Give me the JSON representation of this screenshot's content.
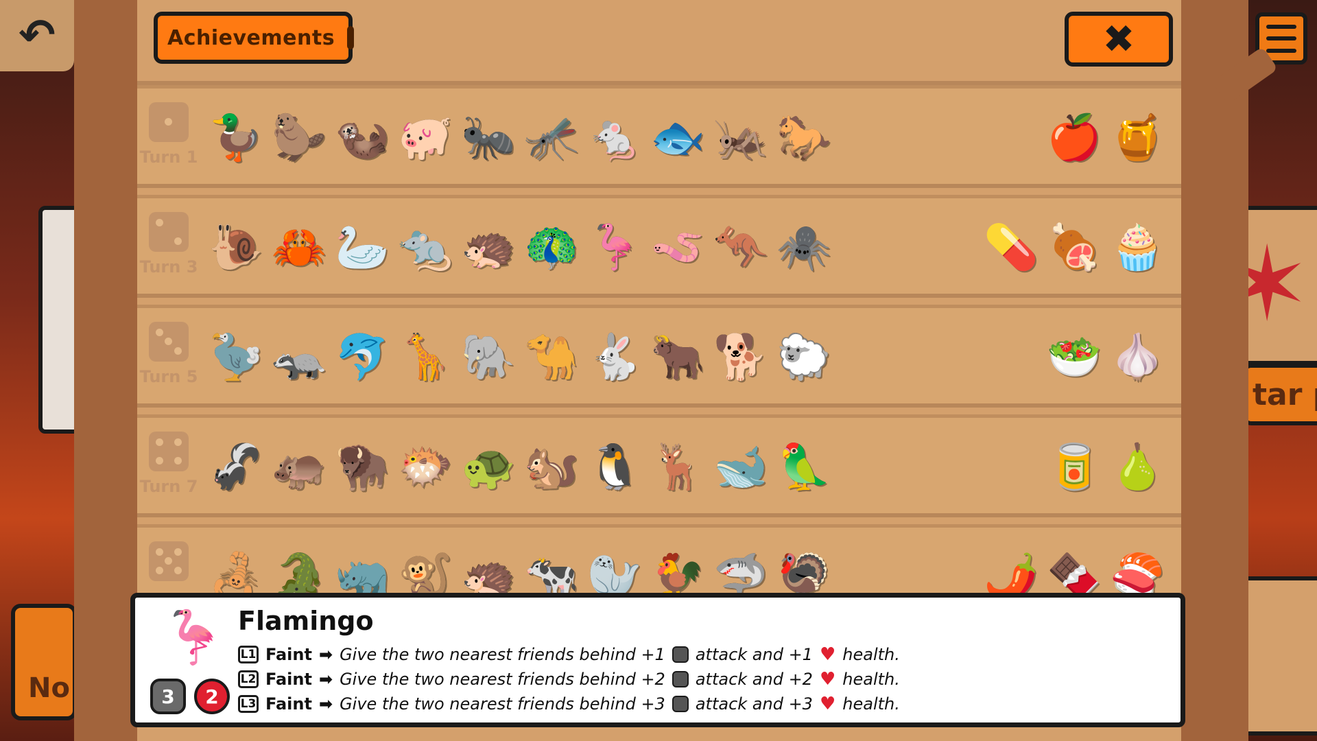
{
  "header": {
    "achievements_label": "Achievements",
    "close_label": "✖"
  },
  "tiers": [
    {
      "turn": "Turn 1",
      "pips": 1,
      "pets": [
        "🦆",
        "🦫",
        "🦦",
        "🐖",
        "🐜",
        "🦟",
        "🐁",
        "🐟",
        "🦗",
        "🐎"
      ],
      "foods": [
        "🍎",
        "🍯"
      ]
    },
    {
      "turn": "Turn 3",
      "pips": 2,
      "pets": [
        "🐌",
        "🦀",
        "🦢",
        "🐀",
        "🦔",
        "🦚",
        "🦩",
        "🪱",
        "🦘",
        "🕷️"
      ],
      "foods": [
        "💊",
        "🍖",
        "🧁"
      ]
    },
    {
      "turn": "Turn 5",
      "pips": 3,
      "pets": [
        "🦤",
        "🦡",
        "🐬",
        "🦒",
        "🐘",
        "🐪",
        "🐇",
        "🐂",
        "🐕",
        "🐑"
      ],
      "foods": [
        "🥗",
        "🧄"
      ]
    },
    {
      "turn": "Turn 7",
      "pips": 4,
      "pets": [
        "🦨",
        "🦛",
        "🦬",
        "🐡",
        "🐢",
        "🐿️",
        "🐧",
        "🦌",
        "🐋",
        "🦜"
      ],
      "foods": [
        "🥫",
        "🍐"
      ]
    },
    {
      "turn": "",
      "pips": 5,
      "pets": [
        "🦂",
        "🐊",
        "🦏",
        "🐒",
        "🦔",
        "🐄",
        "🦭",
        "🐓",
        "🦈",
        "🦃"
      ],
      "foods": [
        "🌶️",
        "🍫",
        "🍣"
      ]
    }
  ],
  "info": {
    "icon": "🦩",
    "name": "Flamingo",
    "attack": "3",
    "health": "2",
    "abilities": [
      {
        "level": "L1",
        "trigger": "Faint",
        "arrow": "➡",
        "text_a": "Give the two nearest friends behind +1",
        "text_b": "attack and +1",
        "text_c": "health."
      },
      {
        "level": "L2",
        "trigger": "Faint",
        "arrow": "➡",
        "text_a": "Give the two nearest friends behind +2",
        "text_b": "attack and +2",
        "text_c": "health."
      },
      {
        "level": "L3",
        "trigger": "Faint",
        "arrow": "➡",
        "text_a": "Give the two nearest friends behind +3",
        "text_b": "attack and +3",
        "text_c": "health."
      }
    ]
  },
  "background": {
    "left_button_text": "No",
    "right_banner_text": "tar pa"
  }
}
